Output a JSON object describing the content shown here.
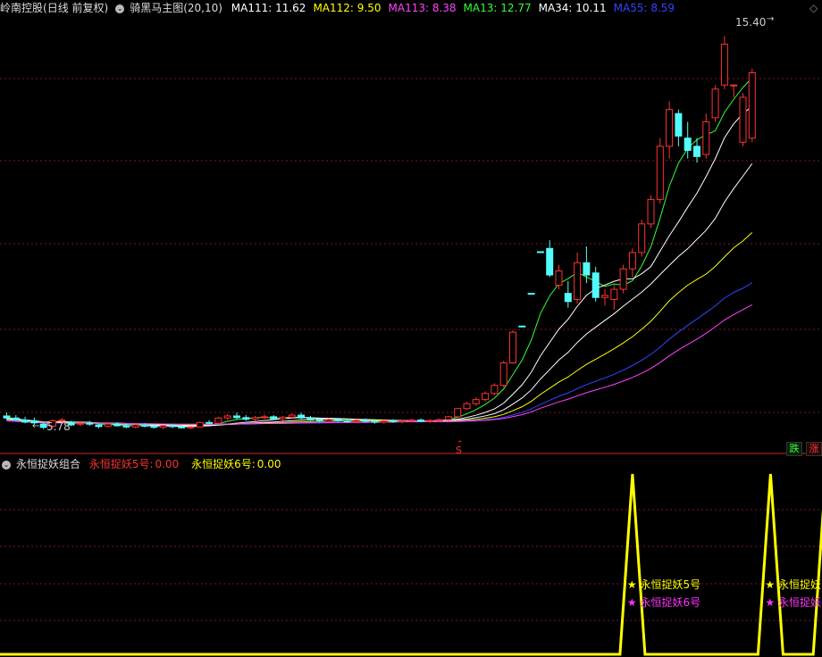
{
  "header": {
    "stock_name": "岭南控股",
    "period": "(日线 前复权)",
    "indicator": "骑黑马主图",
    "params": "(20,10)",
    "ma_values": [
      {
        "label": "MA111:",
        "value": "11.62",
        "color": "#ffffff"
      },
      {
        "label": "MA112:",
        "value": "9.50",
        "color": "#ffff00"
      },
      {
        "label": "MA113:",
        "value": "8.38",
        "color": "#ff44ff"
      },
      {
        "label": "MA13:",
        "value": "12.77",
        "color": "#33ff33"
      },
      {
        "label": "MA34:",
        "value": "10.11",
        "color": "#ffffff"
      },
      {
        "label": "MA55:",
        "value": "8.59",
        "color": "#3344ff"
      }
    ]
  },
  "sub_header": {
    "name": "永恒捉妖组合",
    "sig5_label": "永恒捉妖5号:",
    "sig5_value": "0.00",
    "sig6_label": "永恒捉妖6号:",
    "sig6_value": "0.00"
  },
  "annotations": {
    "high_label": "15.40",
    "low_label": "5.78",
    "s_marker": "S",
    "btn_down": "跌",
    "btn_up": "涨"
  },
  "signal_labels": {
    "sig5": "永恒捉妖5号",
    "sig6": "永恒捉妖6号",
    "star": "★"
  },
  "colors": {
    "up": "#ff3232",
    "down": "#54fcfc",
    "grid": "#7a1a1a",
    "ma13": "#33ff33",
    "ma34": "#ffffff",
    "ma55": "#3344ff",
    "ma111": "#ffffff",
    "ma112": "#ffff00",
    "ma113": "#ff44ff",
    "signal": "#ffff00",
    "sig6color": "#ff33ff"
  },
  "chart_data": {
    "type": "candlestick",
    "price_range": [
      5.4,
      15.8
    ],
    "candles": [
      {
        "o": 6.1,
        "h": 6.18,
        "l": 6.0,
        "c": 6.05
      },
      {
        "o": 6.05,
        "h": 6.12,
        "l": 5.98,
        "c": 6.0
      },
      {
        "o": 6.0,
        "h": 6.08,
        "l": 5.92,
        "c": 5.95
      },
      {
        "o": 5.98,
        "h": 6.06,
        "l": 5.9,
        "c": 5.93
      },
      {
        "o": 5.9,
        "h": 5.95,
        "l": 5.78,
        "c": 5.82
      },
      {
        "o": 5.85,
        "h": 6.02,
        "l": 5.82,
        "c": 5.98
      },
      {
        "o": 5.98,
        "h": 6.05,
        "l": 5.92,
        "c": 6.0
      },
      {
        "o": 5.95,
        "h": 5.98,
        "l": 5.85,
        "c": 5.88
      },
      {
        "o": 5.9,
        "h": 5.97,
        "l": 5.85,
        "c": 5.92
      },
      {
        "o": 5.92,
        "h": 5.98,
        "l": 5.86,
        "c": 5.9
      },
      {
        "o": 5.88,
        "h": 5.92,
        "l": 5.8,
        "c": 5.84
      },
      {
        "o": 5.85,
        "h": 5.93,
        "l": 5.82,
        "c": 5.9
      },
      {
        "o": 5.9,
        "h": 5.95,
        "l": 5.84,
        "c": 5.86
      },
      {
        "o": 5.86,
        "h": 5.91,
        "l": 5.8,
        "c": 5.83
      },
      {
        "o": 5.83,
        "h": 5.9,
        "l": 5.8,
        "c": 5.88
      },
      {
        "o": 5.88,
        "h": 5.92,
        "l": 5.82,
        "c": 5.85
      },
      {
        "o": 5.85,
        "h": 5.9,
        "l": 5.79,
        "c": 5.82
      },
      {
        "o": 5.82,
        "h": 5.88,
        "l": 5.78,
        "c": 5.86
      },
      {
        "o": 5.86,
        "h": 5.9,
        "l": 5.8,
        "c": 5.84
      },
      {
        "o": 5.84,
        "h": 5.88,
        "l": 5.79,
        "c": 5.81
      },
      {
        "o": 5.81,
        "h": 5.85,
        "l": 5.78,
        "c": 5.83
      },
      {
        "o": 5.83,
        "h": 5.96,
        "l": 5.82,
        "c": 5.94
      },
      {
        "o": 5.94,
        "h": 6.0,
        "l": 5.9,
        "c": 5.92
      },
      {
        "o": 5.92,
        "h": 6.08,
        "l": 5.9,
        "c": 6.05
      },
      {
        "o": 6.05,
        "h": 6.15,
        "l": 6.0,
        "c": 6.1
      },
      {
        "o": 6.1,
        "h": 6.18,
        "l": 6.02,
        "c": 6.06
      },
      {
        "o": 6.06,
        "h": 6.12,
        "l": 5.98,
        "c": 6.02
      },
      {
        "o": 6.02,
        "h": 6.1,
        "l": 5.98,
        "c": 6.06
      },
      {
        "o": 6.06,
        "h": 6.14,
        "l": 6.02,
        "c": 6.08
      },
      {
        "o": 6.08,
        "h": 6.12,
        "l": 6.0,
        "c": 6.03
      },
      {
        "o": 6.03,
        "h": 6.1,
        "l": 5.98,
        "c": 6.07
      },
      {
        "o": 6.07,
        "h": 6.16,
        "l": 6.04,
        "c": 6.12
      },
      {
        "o": 6.12,
        "h": 6.18,
        "l": 6.02,
        "c": 6.05
      },
      {
        "o": 6.05,
        "h": 6.1,
        "l": 5.98,
        "c": 6.0
      },
      {
        "o": 6.0,
        "h": 6.06,
        "l": 5.94,
        "c": 5.97
      },
      {
        "o": 5.97,
        "h": 6.04,
        "l": 5.93,
        "c": 6.01
      },
      {
        "o": 6.01,
        "h": 6.05,
        "l": 5.95,
        "c": 5.98
      },
      {
        "o": 5.98,
        "h": 6.03,
        "l": 5.93,
        "c": 5.96
      },
      {
        "o": 5.96,
        "h": 6.02,
        "l": 5.92,
        "c": 5.99
      },
      {
        "o": 5.99,
        "h": 6.04,
        "l": 5.94,
        "c": 5.97
      },
      {
        "o": 5.97,
        "h": 6.02,
        "l": 5.91,
        "c": 5.95
      },
      {
        "o": 5.95,
        "h": 6.0,
        "l": 5.91,
        "c": 5.98
      },
      {
        "o": 5.98,
        "h": 6.02,
        "l": 5.93,
        "c": 5.96
      },
      {
        "o": 5.96,
        "h": 6.0,
        "l": 5.92,
        "c": 5.98
      },
      {
        "o": 5.98,
        "h": 6.03,
        "l": 5.94,
        "c": 6.0
      },
      {
        "o": 6.0,
        "h": 6.04,
        "l": 5.95,
        "c": 5.97
      },
      {
        "o": 5.97,
        "h": 6.02,
        "l": 5.93,
        "c": 5.99
      },
      {
        "o": 5.99,
        "h": 6.03,
        "l": 5.95,
        "c": 6.01
      },
      {
        "o": 6.01,
        "h": 6.1,
        "l": 5.98,
        "c": 6.08
      },
      {
        "o": 6.08,
        "h": 6.3,
        "l": 6.06,
        "c": 6.28
      },
      {
        "o": 6.28,
        "h": 6.45,
        "l": 6.24,
        "c": 6.4
      },
      {
        "o": 6.4,
        "h": 6.55,
        "l": 6.35,
        "c": 6.5
      },
      {
        "o": 6.5,
        "h": 6.7,
        "l": 6.45,
        "c": 6.65
      },
      {
        "o": 6.65,
        "h": 6.9,
        "l": 6.6,
        "c": 6.85
      },
      {
        "o": 6.85,
        "h": 7.45,
        "l": 6.8,
        "c": 7.4
      },
      {
        "o": 7.4,
        "h": 8.2,
        "l": 7.38,
        "c": 8.15
      },
      {
        "o": 8.3,
        "h": 8.3,
        "l": 8.28,
        "c": 8.29
      },
      {
        "o": 9.1,
        "h": 9.1,
        "l": 9.08,
        "c": 9.09
      },
      {
        "o": 10.12,
        "h": 10.12,
        "l": 10.1,
        "c": 10.11
      },
      {
        "o": 10.2,
        "h": 10.4,
        "l": 9.5,
        "c": 9.55
      },
      {
        "o": 9.3,
        "h": 9.8,
        "l": 9.2,
        "c": 9.65
      },
      {
        "o": 9.1,
        "h": 9.4,
        "l": 8.75,
        "c": 8.9
      },
      {
        "o": 8.95,
        "h": 10.1,
        "l": 8.85,
        "c": 9.85
      },
      {
        "o": 9.85,
        "h": 10.25,
        "l": 9.35,
        "c": 9.55
      },
      {
        "o": 9.6,
        "h": 9.75,
        "l": 8.9,
        "c": 9.0
      },
      {
        "o": 9.0,
        "h": 9.2,
        "l": 8.8,
        "c": 9.05
      },
      {
        "o": 8.95,
        "h": 9.3,
        "l": 8.7,
        "c": 9.2
      },
      {
        "o": 9.2,
        "h": 9.8,
        "l": 9.1,
        "c": 9.7
      },
      {
        "o": 9.7,
        "h": 10.2,
        "l": 9.5,
        "c": 10.1
      },
      {
        "o": 10.1,
        "h": 10.9,
        "l": 10.0,
        "c": 10.8
      },
      {
        "o": 10.8,
        "h": 11.5,
        "l": 10.7,
        "c": 11.4
      },
      {
        "o": 11.4,
        "h": 12.9,
        "l": 11.3,
        "c": 12.7
      },
      {
        "o": 12.7,
        "h": 13.8,
        "l": 12.4,
        "c": 13.6
      },
      {
        "o": 13.5,
        "h": 13.6,
        "l": 12.7,
        "c": 12.95
      },
      {
        "o": 12.9,
        "h": 13.3,
        "l": 12.4,
        "c": 12.6
      },
      {
        "o": 12.7,
        "h": 12.9,
        "l": 12.3,
        "c": 12.45
      },
      {
        "o": 12.5,
        "h": 13.5,
        "l": 12.4,
        "c": 13.3
      },
      {
        "o": 13.4,
        "h": 14.2,
        "l": 13.3,
        "c": 14.1
      },
      {
        "o": 14.2,
        "h": 15.4,
        "l": 14.1,
        "c": 15.2
      },
      {
        "o": 14.2,
        "h": 14.2,
        "l": 13.9,
        "c": 14.2
      },
      {
        "o": 12.8,
        "h": 14.0,
        "l": 12.7,
        "c": 13.9
      },
      {
        "o": 12.9,
        "h": 14.6,
        "l": 12.8,
        "c": 14.5
      }
    ],
    "signal_peaks_index": [
      68,
      83,
      89
    ]
  }
}
